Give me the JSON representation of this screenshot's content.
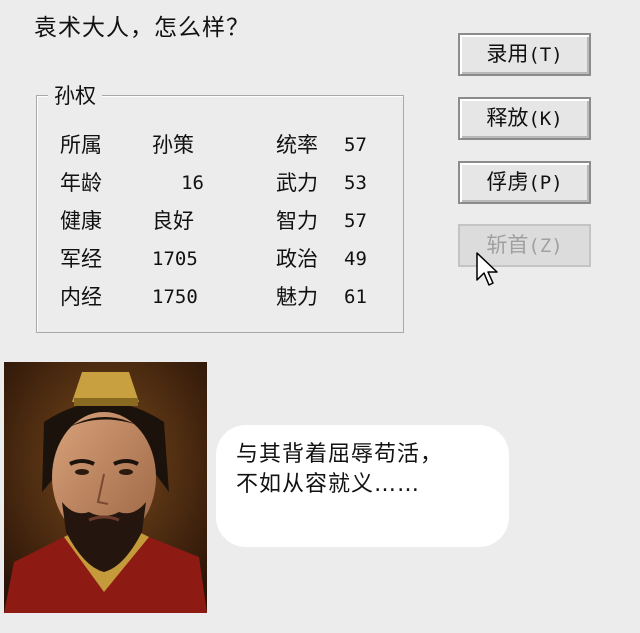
{
  "prompt": "袁术大人，怎么样？",
  "officer": {
    "name": "孙权",
    "left_stats": [
      {
        "label": "所属",
        "value": "孙策"
      },
      {
        "label": "年龄",
        "value": "16"
      },
      {
        "label": "健康",
        "value": "良好"
      },
      {
        "label": "军经",
        "value": "1705"
      },
      {
        "label": "内经",
        "value": "1750"
      }
    ],
    "right_stats": [
      {
        "label": "统率",
        "value": "57"
      },
      {
        "label": "武力",
        "value": "53"
      },
      {
        "label": "智力",
        "value": "57"
      },
      {
        "label": "政治",
        "value": "49"
      },
      {
        "label": "魅力",
        "value": "61"
      }
    ]
  },
  "actions": [
    {
      "label": "录用",
      "hotkey": "(T)",
      "enabled": true
    },
    {
      "label": "释放",
      "hotkey": "(K)",
      "enabled": true
    },
    {
      "label": "俘虏",
      "hotkey": "(P)",
      "enabled": true
    },
    {
      "label": "斩首",
      "hotkey": "(Z)",
      "enabled": false
    }
  ],
  "speech": "与其背着屈辱苟活，\n不如从容就义……",
  "colors": {
    "background": "#ececec",
    "bubble": "#ffffff",
    "disabled_text": "#a0a0a0"
  }
}
